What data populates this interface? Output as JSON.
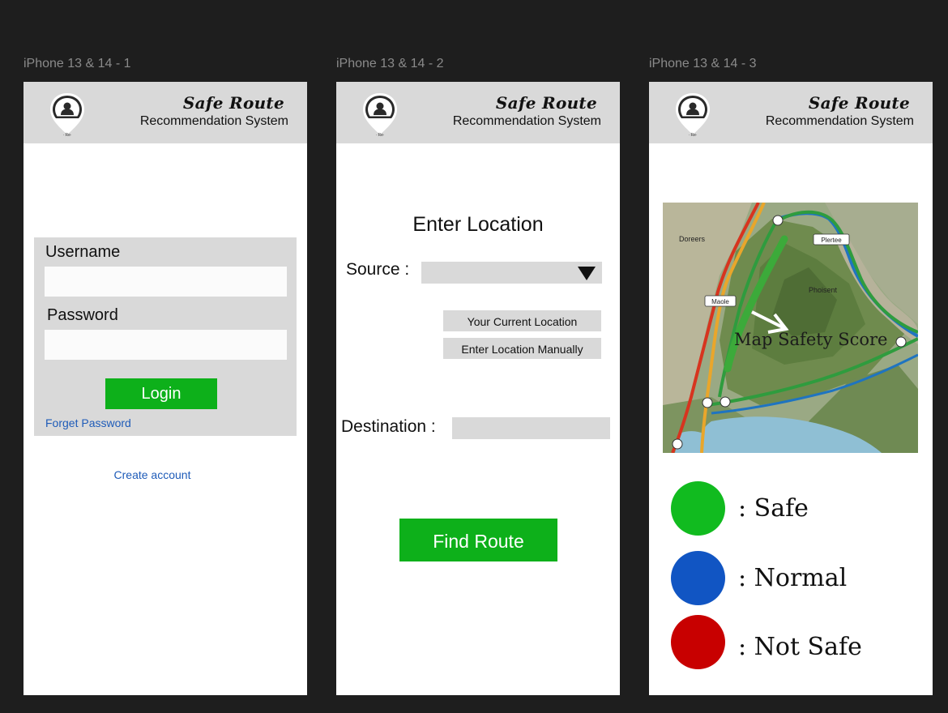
{
  "frames": [
    {
      "label": "iPhone 13 & 14 - 1"
    },
    {
      "label": "iPhone 13 & 14 - 2"
    },
    {
      "label": "iPhone 13 & 14 - 3"
    }
  ],
  "header": {
    "title": "Safe Route",
    "subtitle": "Recommendation System",
    "logo_icon": "location-pin-person-icon"
  },
  "login": {
    "username_label": "Username",
    "username_value": "",
    "password_label": "Password",
    "password_value": "",
    "login_button": "Login",
    "forget_password": "Forget Password",
    "create_account": "Create account"
  },
  "location": {
    "heading": "Enter Location",
    "source_label": "Source :",
    "source_value": "",
    "dropdown_icon": "triangle-down-icon",
    "option_current": "Your Current Location",
    "option_manual": "Enter Location Manually",
    "destination_label": "Destination :",
    "destination_value": "",
    "find_button": "Find Route"
  },
  "result": {
    "map_caption": "Map Safety Score",
    "map_places": [
      "Doreers",
      "Plertee",
      "Phoisent",
      "Maole"
    ],
    "legend": [
      {
        "label": ": Safe",
        "color": "#11bb1f"
      },
      {
        "label": ": Normal",
        "color": "#1155c3"
      },
      {
        "label": ": Not Safe",
        "color": "#c80000"
      }
    ]
  },
  "colors": {
    "background": "#1e1e1e",
    "header": "#d9d9d9",
    "accent_green": "#0db01a",
    "link_blue": "#1e5bb8"
  }
}
